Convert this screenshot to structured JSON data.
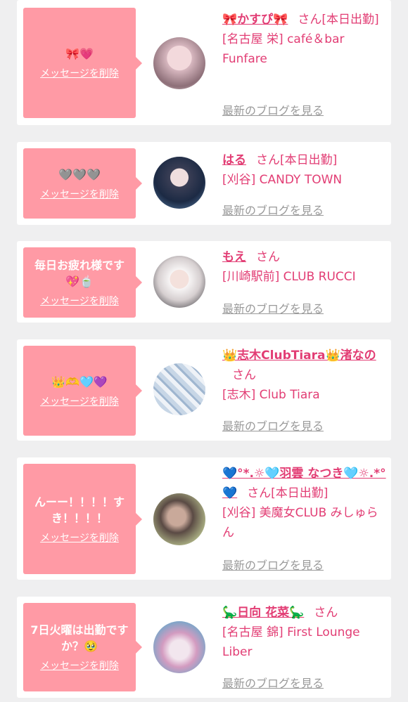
{
  "cards": [
    {
      "message": "🎀💗",
      "delete_label": "メッセージを削除",
      "name": "🎀かすぴ🎀",
      "honorific": "さん",
      "status": "[本日出勤]",
      "shop": "[名古屋 栄] café＆bar Funfare",
      "blog_label": "最新のブログを見る",
      "avatar_icon": "girl-photo"
    },
    {
      "message": "🩶🩶🩶",
      "delete_label": "メッセージを削除",
      "name": "はる",
      "honorific": "さん",
      "status": "[本日出勤]",
      "shop": "[刈谷] CANDY TOWN",
      "blog_label": "最新のブログを見る",
      "avatar_icon": "girl-photo"
    },
    {
      "message": "毎日お疲れ様です💖🍵",
      "delete_label": "メッセージを削除",
      "name": "もえ",
      "honorific": "さん",
      "status": "",
      "shop": "[川崎駅前] CLUB RUCCI",
      "blog_label": "最新のブログを見る",
      "avatar_icon": "girl-photo"
    },
    {
      "message": "👑🫶🩵💜",
      "delete_label": "メッセージを削除",
      "name": "👑志木ClubTiara👑渚なの",
      "honorific": "さん",
      "status": "",
      "shop": "[志木] Club Tiara",
      "blog_label": "最新のブログを見る",
      "avatar_icon": "girl-photo"
    },
    {
      "message": "んーー！！！！すき！！！！",
      "delete_label": "メッセージを削除",
      "name": "💙°*.☼🩵羽雲 なつき🩵☼.*°💙",
      "honorific": "さん",
      "status": "[本日出勤]",
      "shop": "[刈谷] 美魔女CLUB みしゅらん",
      "blog_label": "最新のブログを見る",
      "avatar_icon": "girl-photo"
    },
    {
      "message": "7日火曜は出勤ですか？🥹",
      "delete_label": "メッセージを削除",
      "name": "🦕日向 花菜🦕",
      "honorific": "さん",
      "status": "",
      "shop": "[名古屋 錦] First Lounge Liber",
      "blog_label": "最新のブログを見る",
      "avatar_icon": "girl-photo"
    }
  ]
}
